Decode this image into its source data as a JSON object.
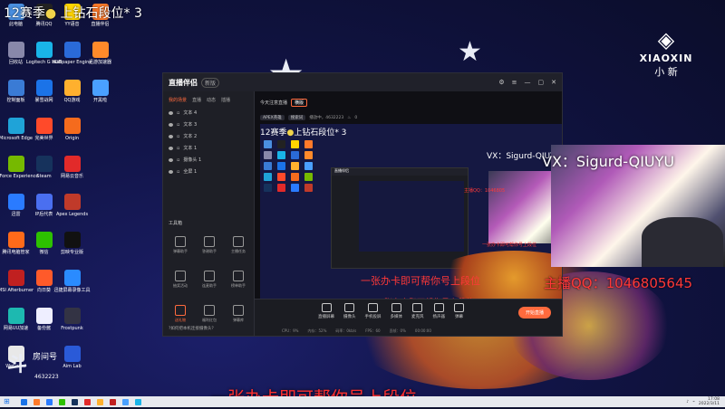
{
  "desktop": {
    "icons": [
      {
        "label": "此电脑",
        "color": "#4a8fe0"
      },
      {
        "label": "腾讯QQ",
        "color": "#222"
      },
      {
        "label": "YY语音",
        "color": "#ffd400"
      },
      {
        "label": "直播伴侣",
        "color": "#ff7a2a"
      },
      {
        "label": "回收站",
        "color": "#88a"
      },
      {
        "label": "Logitech G HUB",
        "color": "#19b4e8"
      },
      {
        "label": "Wallpaper Engine",
        "color": "#2a6ad8"
      },
      {
        "label": "迅游加速器",
        "color": "#ff8a2a"
      },
      {
        "label": "控制面板",
        "color": "#3a7bd5"
      },
      {
        "label": "暴雪战网",
        "color": "#1b73e8"
      },
      {
        "label": "QQ游戏",
        "color": "#ffb02e"
      },
      {
        "label": "开黑啦",
        "color": "#4aa0ff"
      },
      {
        "label": "Microsoft Edge",
        "color": "#1fa3d8"
      },
      {
        "label": "完美世界",
        "color": "#ff4a2a"
      },
      {
        "label": "Origin",
        "color": "#f56b1d"
      },
      {
        "label": "",
        "color": "transparent"
      },
      {
        "label": "GeForce Experience",
        "color": "#76b900"
      },
      {
        "label": "Steam",
        "color": "#16325c"
      },
      {
        "label": "网易云音乐",
        "color": "#e22a2a"
      },
      {
        "label": "",
        "color": "transparent"
      },
      {
        "label": "迅雷",
        "color": "#2a7bff"
      },
      {
        "label": "IP后代表",
        "color": "#4a6ff0"
      },
      {
        "label": "Apex Legends",
        "color": "#c03a2a"
      },
      {
        "label": "",
        "color": "transparent"
      },
      {
        "label": "腾讯电脑管家",
        "color": "#ff6a1a"
      },
      {
        "label": "微信",
        "color": "#2dc100"
      },
      {
        "label": "剪映专业版",
        "color": "#111"
      },
      {
        "label": "",
        "color": "transparent"
      },
      {
        "label": "MSI Afterburner",
        "color": "#c02020"
      },
      {
        "label": "向日葵",
        "color": "#ff5a2a"
      },
      {
        "label": "迅捷屏幕录像工具",
        "color": "#2a8bff"
      },
      {
        "label": "",
        "color": "transparent"
      },
      {
        "label": "网易UU加速",
        "color": "#1db9b0"
      },
      {
        "label": "备份酱",
        "color": "#eef"
      },
      {
        "label": "Frostpunk",
        "color": "#334"
      },
      {
        "label": "",
        "color": "transparent"
      },
      {
        "label": "WeGame",
        "color": "#e8e8e8"
      },
      {
        "label": "",
        "color": "transparent"
      },
      {
        "label": "Aim Lab",
        "color": "#2a5ad8"
      },
      {
        "label": "",
        "color": "transparent"
      }
    ]
  },
  "overlay": {
    "title_a": "12赛季",
    "title_b": "上钻石段位* 3",
    "vx": "VX：Sigurd-QIUYU",
    "qq": "主播QQ：1046805645",
    "mid_red": "一张办卡即可帮你号上段位",
    "bottom_red": "一张办卡即可帮你号上段位",
    "badge_num": "4632223",
    "badge_label": "房间号"
  },
  "brand": {
    "logo_text": "XIAOXIN",
    "logo_cn": "小 新"
  },
  "app": {
    "title": "直播伴侣",
    "version": "新版",
    "left_tabs": [
      "我的场景",
      "直播",
      "动态",
      "插播"
    ],
    "sources": [
      "文本 4",
      "文本 3",
      "文本 2",
      "文本 1",
      "摄像头 1",
      "全屏 1"
    ],
    "tools_title": "工具箱",
    "tools": [
      {
        "label": "弹幕助手",
        "hl": false
      },
      {
        "label": "答谢助手",
        "hl": false
      },
      {
        "label": "主播任务",
        "hl": false
      },
      {
        "label": "抽奖活动",
        "hl": false
      },
      {
        "label": "连麦助手",
        "hl": false
      },
      {
        "label": "榜单助手",
        "hl": false
      },
      {
        "label": "送礼物",
        "hl": true
      },
      {
        "label": "福利红包",
        "hl": false
      },
      {
        "label": "弹幕库",
        "hl": false
      }
    ],
    "left_footer": "如何把本机连接摄像头？",
    "scene_title": "今天注意直播",
    "scene_tag": "横版",
    "scene_pills": [
      "APEX英雄",
      "搜索词"
    ],
    "scene_info": "播放中，4632223",
    "scene_likes": "0",
    "preview_title_a": "12赛季",
    "preview_title_b": "上钻石段位* 3",
    "preview_vx": "VX：Sigurd-QIUYU",
    "preview_qq": "主播QQ：1046805",
    "preview_red": "一张办卡即可帮你号上段位",
    "bottom_buttons": [
      "直播屏幕",
      "摄像头",
      "手机投屏",
      "多媒体",
      "麦克风",
      "扬声器",
      "弹幕"
    ],
    "live_button": "开始直播",
    "stats": [
      "CPU：9%",
      "内存：52%",
      "码率：0kb/s",
      "FPS：60",
      "丢帧：0%",
      "00:00:00"
    ]
  },
  "taskbar": {
    "time": "17:08",
    "date": "2022/3/11",
    "icons": [
      "#1a73e8",
      "#ff7a2a",
      "#2a7bff",
      "#2dc100",
      "#16325c",
      "#e22a2a",
      "#ffb02e",
      "#c02020",
      "#4aa0ff",
      "#19b4e8"
    ]
  }
}
